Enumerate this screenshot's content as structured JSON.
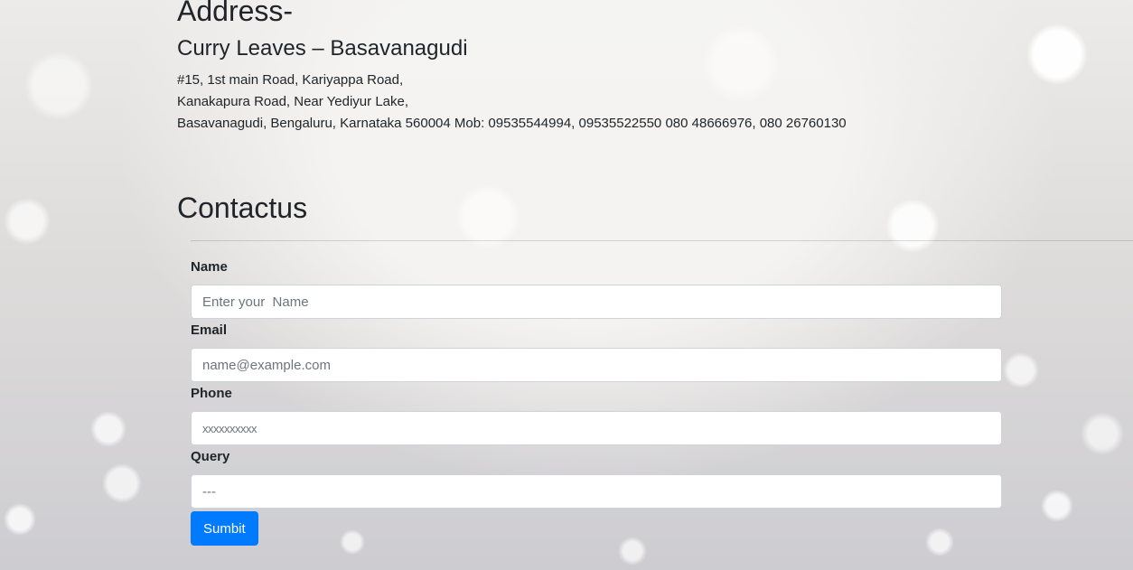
{
  "address": {
    "heading": "Address-",
    "branch_name": "Curry Leaves – Basavanagudi",
    "lines": [
      "#15, 1st main Road, Kariyappa Road,",
      "Kanakapura Road, Near Yediyur Lake,",
      "Basavanagudi, Bengaluru, Karnataka 560004 Mob: 09535544994, 09535522550 080 48666976, 080 26760130"
    ]
  },
  "contact": {
    "heading": "Contactus",
    "fields": {
      "name": {
        "label": "Name",
        "placeholder": "Enter your  Name",
        "value": ""
      },
      "email": {
        "label": "Email",
        "placeholder": "name@example.com",
        "value": ""
      },
      "phone": {
        "label": "Phone",
        "placeholder": "xxxxxxxxxx",
        "value": ""
      },
      "query": {
        "label": "Query",
        "placeholder": "---",
        "value": ""
      }
    },
    "submit_label": "Sumbit"
  },
  "colors": {
    "primary_button": "#007bff",
    "text": "#212529",
    "input_border": "#ced4da"
  }
}
